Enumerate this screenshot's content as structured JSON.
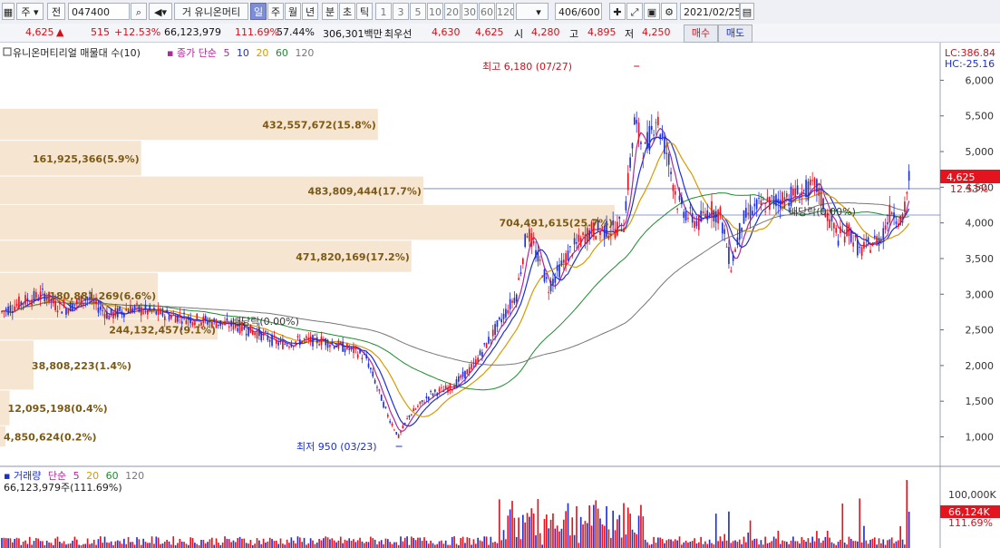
{
  "toolbar": {
    "market": "주",
    "period_btn": "전",
    "code": "047400",
    "name_prefix": "거",
    "stock_name": "유니온머티",
    "timeframes": [
      "일",
      "주",
      "월",
      "년",
      "분",
      "초",
      "틱"
    ],
    "selected_timeframe": "일",
    "minute_options": [
      "1",
      "3",
      "5",
      "10",
      "20",
      "30",
      "60",
      "120"
    ],
    "count": "406/600",
    "date": "2021/02/25"
  },
  "quote": {
    "price": "4,625",
    "change_arrow": "▲",
    "change": "515",
    "change_pct": "+12.53%",
    "volume": "66,123,979",
    "volume_ratio": "111.69%",
    "turnover": "57.44%",
    "amount": "306,301백만",
    "best_bid_label": "최우선",
    "best_ask": "4,630",
    "best_bid": "4,625",
    "open_label": "시",
    "open": "4,280",
    "high_label": "고",
    "high": "4,895",
    "low_label": "저",
    "low": "4,250",
    "buy": "매수",
    "sell": "매도"
  },
  "legend": {
    "title": "유니온머티리얼 매물대 수(10)",
    "ma_label": "종가 단순",
    "ma_periods": [
      "5",
      "10",
      "20",
      "60",
      "120"
    ],
    "ma_colors": [
      "#b0289a",
      "#1d2fd6",
      "#d89a00",
      "#1c8c2e",
      "#777777"
    ]
  },
  "right_panel": {
    "lc": "LC:386.84",
    "hc": "HC:-25.16",
    "last_price": "4,625",
    "last_pct": "12.53%",
    "vol_last": "66,124K",
    "vol_pct": "111.69%",
    "vol_tick": "100,000K"
  },
  "volume_legend": {
    "title": "거래량",
    "ma_label": "단순",
    "periods": [
      "5",
      "20",
      "60",
      "120"
    ],
    "colors": [
      "#b0289a",
      "#d89a00",
      "#1c8c2e",
      "#777777"
    ],
    "summary": "66,123,979주(111.69%)"
  },
  "chart_data": {
    "type": "candlestick",
    "y_ticks": [
      1000,
      1500,
      2000,
      2500,
      3000,
      3500,
      4000,
      4500,
      5000,
      5500,
      6000
    ],
    "ylim": [
      650,
      6400
    ],
    "annotations": {
      "high": "최고 6,180 (07/27)",
      "low": "최저 950 (03/23)",
      "box": "배당락(0.00%)"
    },
    "volume_profile": [
      {
        "label": "4,850,624(0.2%)",
        "low": 850,
        "high": 1150,
        "pct": 0.2
      },
      {
        "label": "12,095,198(0.4%)",
        "low": 1150,
        "high": 1650,
        "pct": 0.4
      },
      {
        "label": "38,808,223(1.4%)",
        "low": 1650,
        "high": 2350,
        "pct": 1.4
      },
      {
        "label": "244,132,457(9.1%)",
        "low": 2350,
        "high": 2650,
        "pct": 9.1
      },
      {
        "label": "180,881,269(6.6%)",
        "low": 2650,
        "high": 3300,
        "pct": 6.6
      },
      {
        "label": "471,820,169(17.2%)",
        "low": 3300,
        "high": 3750,
        "pct": 17.2
      },
      {
        "label": "704,491,615(25.7%)",
        "low": 3750,
        "high": 4250,
        "pct": 25.7
      },
      {
        "label": "483,809,444(17.7%)",
        "low": 4250,
        "high": 4650,
        "pct": 17.7
      },
      {
        "label": "161,925,366(5.9%)",
        "low": 4650,
        "high": 5150,
        "pct": 5.9
      },
      {
        "label": "432,557,672(15.8%)",
        "low": 5150,
        "high": 5600,
        "pct": 15.8
      }
    ],
    "price_path": [
      {
        "i": 0,
        "c": 2750
      },
      {
        "i": 10,
        "c": 2900
      },
      {
        "i": 20,
        "c": 3000
      },
      {
        "i": 25,
        "c": 2850
      },
      {
        "i": 30,
        "c": 2800
      },
      {
        "i": 40,
        "c": 2950
      },
      {
        "i": 50,
        "c": 2700
      },
      {
        "i": 60,
        "c": 2800
      },
      {
        "i": 70,
        "c": 2750
      },
      {
        "i": 80,
        "c": 2700
      },
      {
        "i": 90,
        "c": 2650
      },
      {
        "i": 100,
        "c": 2600
      },
      {
        "i": 110,
        "c": 2550
      },
      {
        "i": 120,
        "c": 2450
      },
      {
        "i": 130,
        "c": 2300
      },
      {
        "i": 140,
        "c": 2350
      },
      {
        "i": 150,
        "c": 2350
      },
      {
        "i": 160,
        "c": 2250
      },
      {
        "i": 165,
        "c": 2200
      },
      {
        "i": 170,
        "c": 2100
      },
      {
        "i": 175,
        "c": 1700
      },
      {
        "i": 180,
        "c": 1300
      },
      {
        "i": 185,
        "c": 1000
      },
      {
        "i": 190,
        "c": 1300
      },
      {
        "i": 200,
        "c": 1600
      },
      {
        "i": 210,
        "c": 1700
      },
      {
        "i": 220,
        "c": 2000
      },
      {
        "i": 230,
        "c": 2500
      },
      {
        "i": 240,
        "c": 3000
      },
      {
        "i": 245,
        "c": 3900
      },
      {
        "i": 250,
        "c": 3500
      },
      {
        "i": 255,
        "c": 3100
      },
      {
        "i": 265,
        "c": 3600
      },
      {
        "i": 275,
        "c": 3900
      },
      {
        "i": 285,
        "c": 3900
      },
      {
        "i": 290,
        "c": 4000
      },
      {
        "i": 295,
        "c": 5400
      },
      {
        "i": 300,
        "c": 5000
      },
      {
        "i": 305,
        "c": 5500
      },
      {
        "i": 310,
        "c": 5000
      },
      {
        "i": 315,
        "c": 4300
      },
      {
        "i": 320,
        "c": 4100
      },
      {
        "i": 325,
        "c": 4000
      },
      {
        "i": 330,
        "c": 4200
      },
      {
        "i": 335,
        "c": 4100
      },
      {
        "i": 340,
        "c": 3400
      },
      {
        "i": 345,
        "c": 4000
      },
      {
        "i": 350,
        "c": 4200
      },
      {
        "i": 360,
        "c": 4300
      },
      {
        "i": 370,
        "c": 4400
      },
      {
        "i": 380,
        "c": 4500
      },
      {
        "i": 385,
        "c": 4100
      },
      {
        "i": 390,
        "c": 3800
      },
      {
        "i": 395,
        "c": 3900
      },
      {
        "i": 400,
        "c": 3600
      },
      {
        "i": 405,
        "c": 3700
      },
      {
        "i": 410,
        "c": 3800
      },
      {
        "i": 415,
        "c": 4200
      },
      {
        "i": 420,
        "c": 4000
      },
      {
        "i": 423,
        "c": 4625
      }
    ]
  }
}
